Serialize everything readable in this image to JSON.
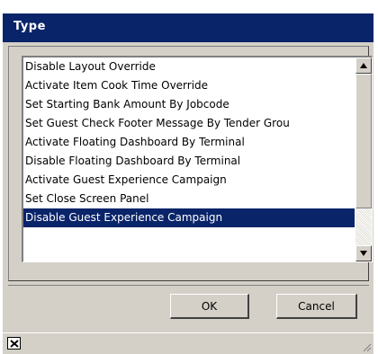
{
  "dialog": {
    "title": "Type"
  },
  "list": {
    "items": [
      "Disable Layout Override",
      "Activate Item Cook Time Override",
      "Set Starting Bank Amount By Jobcode",
      "Set Guest Check Footer Message By Tender Grou",
      "Activate Floating Dashboard By Terminal",
      "Disable Floating Dashboard By Terminal",
      "Activate Guest Experience Campaign",
      "Set Close Screen Panel",
      "Disable Guest Experience Campaign"
    ],
    "selected_index": 8
  },
  "buttons": {
    "ok_label": "OK",
    "cancel_label": "Cancel"
  },
  "icons": {
    "scroll_up": "triangle-up-icon",
    "scroll_down": "triangle-down-icon",
    "close": "close-icon",
    "resize_grip": "resize-grip-icon"
  },
  "colors": {
    "title_bar": "#0a246a",
    "selection": "#0a246a",
    "face": "#d4d0c8"
  }
}
